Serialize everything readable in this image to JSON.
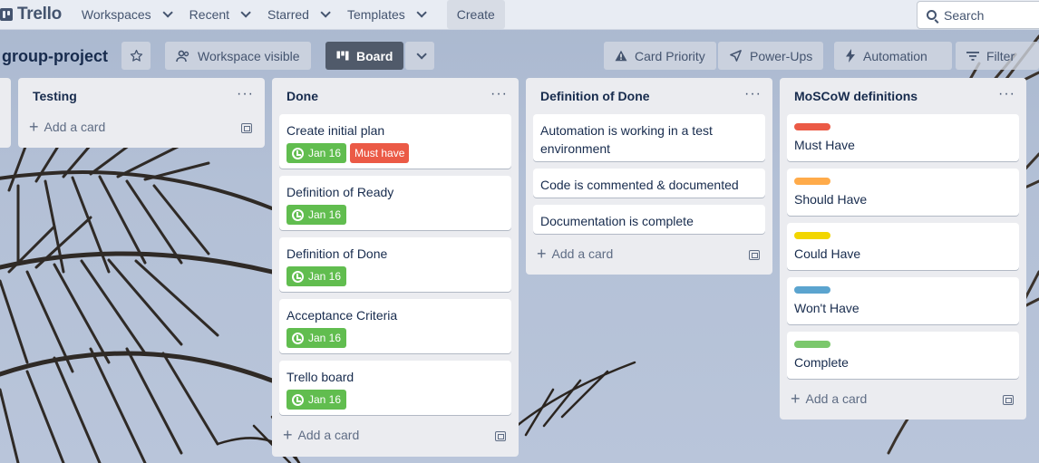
{
  "topnav": {
    "logo": "Trello",
    "menus": [
      "Workspaces",
      "Recent",
      "Starred",
      "Templates"
    ],
    "create": "Create",
    "search_placeholder": "Search"
  },
  "board": {
    "title": "group-project",
    "visibility": "Workspace visible",
    "view": "Board",
    "actions": [
      "Card Priority",
      "Power-Ups",
      "Automation",
      "Filter"
    ]
  },
  "lists": {
    "testing": {
      "title": "Testing",
      "menu": "···",
      "add_card": "Add a card"
    },
    "done": {
      "title": "Done",
      "menu": "···",
      "cards": [
        {
          "title": "Create initial plan",
          "date": "Jan 16",
          "label": "Must have"
        },
        {
          "title": "Definition of Ready",
          "date": "Jan 16"
        },
        {
          "title": "Definition of Done",
          "date": "Jan 16"
        },
        {
          "title": "Acceptance Criteria",
          "date": "Jan 16"
        },
        {
          "title": "Trello board",
          "date": "Jan 16"
        }
      ],
      "add_card": "Add a card"
    },
    "dod": {
      "title": "Definition of Done",
      "menu": "···",
      "cards": [
        {
          "title": "Automation is working in a test environment"
        },
        {
          "title": "Code is commented & documented"
        },
        {
          "title": "Documentation is complete"
        }
      ],
      "add_card": "Add a card"
    },
    "moscow": {
      "title": "MoSCoW definitions",
      "menu": "···",
      "cards": [
        {
          "title": "Must Have",
          "color": "#eb5a46"
        },
        {
          "title": "Should Have",
          "color": "#ffab4a"
        },
        {
          "title": "Could Have",
          "color": "#f2d600"
        },
        {
          "title": "Won't Have",
          "color": "#5ba4cf"
        },
        {
          "title": "Complete",
          "color": "#7bc86c"
        }
      ],
      "add_card": "Add a card"
    }
  }
}
